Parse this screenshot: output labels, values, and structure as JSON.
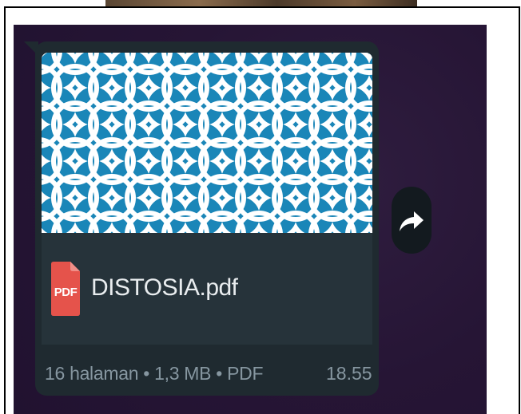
{
  "message": {
    "file_name": "DISTOSIA.pdf",
    "file_type_badge": "PDF",
    "meta": "16 halaman • 1,3 MB • PDF",
    "time": "18.55"
  },
  "icons": {
    "file": "pdf-icon",
    "forward": "forward-icon"
  },
  "colors": {
    "chat_background": "#261535",
    "bubble": "#1f2a30",
    "thumbnail_blue": "#1a86b8",
    "pdf_red": "#e5534b",
    "meta_text": "#8696a0"
  }
}
